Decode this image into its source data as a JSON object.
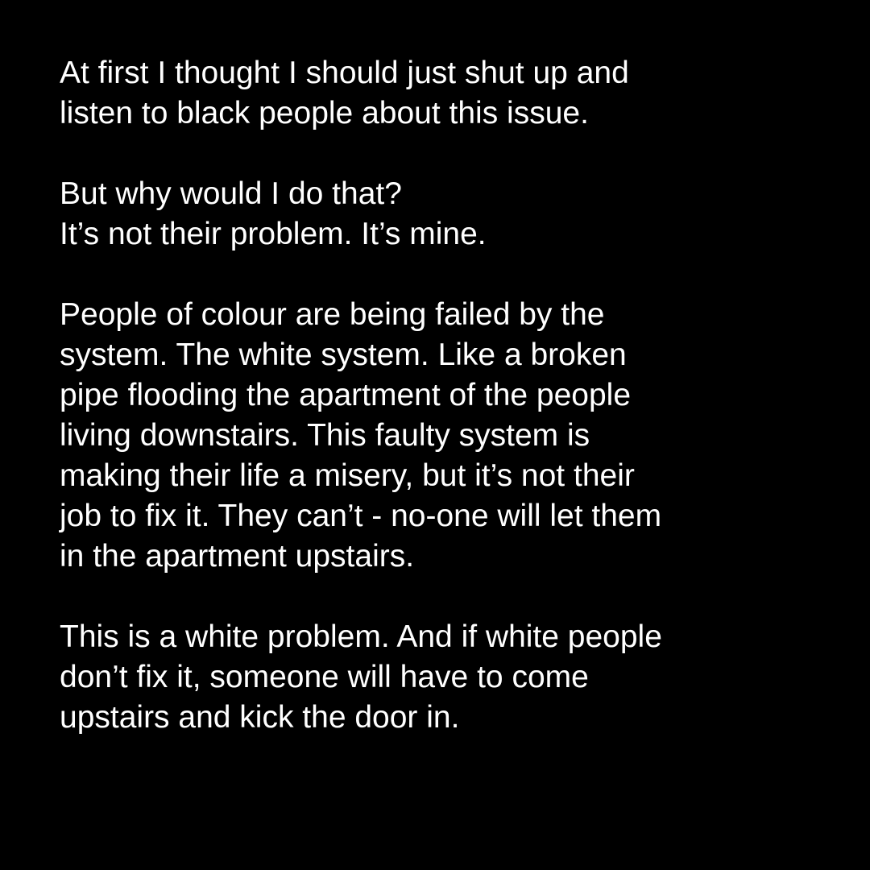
{
  "post": {
    "paragraphs": [
      {
        "lines": [
          "At first I thought I should just shut up and",
          "listen to black people about this issue."
        ]
      },
      {
        "lines": [
          "But why would I do that?",
          "It’s not their problem. It’s mine."
        ]
      },
      {
        "lines": [
          "People of colour are being failed by the",
          "system. The white system. Like a broken",
          "pipe flooding the apartment of the people",
          "living downstairs. This faulty system is",
          "making their life a misery, but it’s not their",
          "job to fix it. They can’t - no-one will let them",
          "in the apartment upstairs."
        ]
      },
      {
        "lines": [
          "This is a white problem. And if white people",
          "don’t fix it, someone will have to come",
          "upstairs and kick the door in."
        ]
      }
    ]
  },
  "colors": {
    "background": "#000000",
    "text": "#ffffff"
  }
}
